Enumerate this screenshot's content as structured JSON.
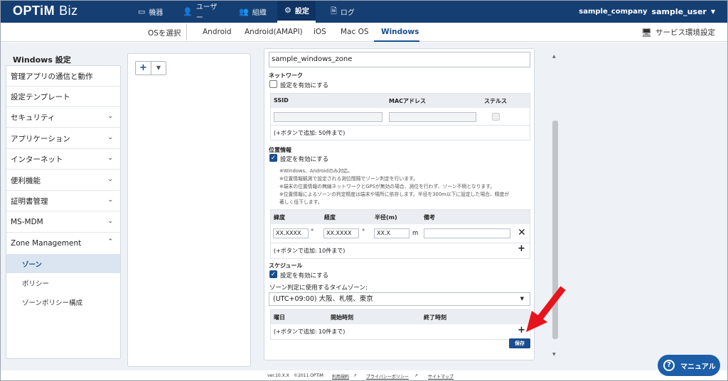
{
  "header": {
    "logo_main": "OPTiM",
    "logo_sub": "Biz",
    "nav": [
      {
        "label": "機器",
        "icon": "devices-icon"
      },
      {
        "label": "ユーザー",
        "icon": "user-icon"
      },
      {
        "label": "組織",
        "icon": "organization-icon"
      },
      {
        "label": "設定",
        "icon": "gear-icon"
      },
      {
        "label": "ログ",
        "icon": "log-icon"
      }
    ],
    "company": "sample_company",
    "user": "sample_user"
  },
  "subnav": {
    "os_select": "OSを選択",
    "tabs": [
      "Android",
      "Android(AMAPI)",
      "iOS",
      "Mac OS",
      "Windows"
    ],
    "service_settings": "サービス環境設定"
  },
  "sidebar": {
    "title": "Windows 設定",
    "items": [
      "管理アプリの通信と動作",
      "設定テンプレート",
      "セキュリティ",
      "アプリケーション",
      "インターネット",
      "便利機能",
      "証明書管理",
      "MS-MDM",
      "Zone Management"
    ],
    "sub_items": [
      "ゾーン",
      "ポリシー",
      "ゾーンポリシー構成"
    ]
  },
  "middle": {
    "add_label": "+",
    "dropdown_label": "⌄"
  },
  "form": {
    "zone_name": "sample_windows_zone",
    "network": {
      "title": "ネットワーク",
      "enable_label": "設定を有効にする",
      "enabled": false,
      "columns": [
        "SSID",
        "MACアドレス",
        "ステルス"
      ],
      "add_note": "(+ボタンで追加: 50件まで)"
    },
    "location": {
      "title": "位置情報",
      "enable_label": "設定を有効にする",
      "enabled": true,
      "notes": [
        "※Windows、Androidのみ対応。",
        "※位置情報観測で設定される測位間隔でゾーン判定を行います。",
        "※端末の位置情報の無線ネットワークとGPSが無効の場合、測位を行わず、ゾーン不明となります。",
        "※位置情報によるゾーンの判定精度は端末や場所に依存します。半径を300m以下に設定した場合、精度が",
        "著しく低下します。"
      ],
      "columns": [
        "緯度",
        "経度",
        "半径(m)",
        "備考"
      ],
      "lat_placeholder": "XX.XXXX",
      "lon_placeholder": "XX.XXXX",
      "radius_placeholder": "XX.X",
      "degree": "°",
      "unit_m": "m",
      "add_note": "(+ボタンで追加: 10件まで)"
    },
    "schedule": {
      "title": "スケジュール",
      "enable_label": "設定を有効にする",
      "enabled": true,
      "tz_label": "ゾーン判定に使用するタイムゾーン:",
      "tz_value": "(UTC+09:00) 大阪、札幌、東京",
      "columns": [
        "曜日",
        "開始時刻",
        "終了時刻"
      ],
      "add_note": "(+ボタンで追加: 10件まで)"
    },
    "save_label": "保存"
  },
  "footer": {
    "version": "ver.10.X.X",
    "copyright": "©2011 OPTiM",
    "terms": "利用規約",
    "privacy": "プライバシーポリシー",
    "sitemap": "サイトマップ"
  },
  "manual_button": "マニュアル",
  "colors": {
    "header_bg": "#153f73",
    "accent": "#1a4d8f",
    "arrow": "#e8141b"
  }
}
